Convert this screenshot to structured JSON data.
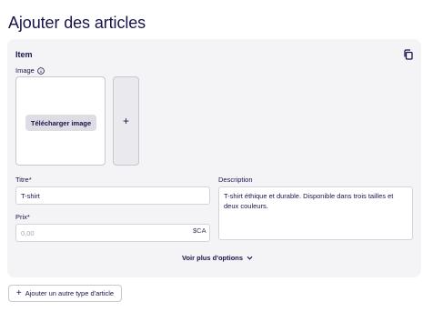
{
  "page": {
    "title": "Ajouter des articles"
  },
  "item_card": {
    "title": "Item",
    "copy_icon": "copy-icon",
    "image": {
      "label": "Image",
      "info_icon": "info-icon",
      "upload_button_label": "Télécharger image",
      "add_icon": "+"
    },
    "title_field": {
      "label": "Titre*",
      "value": "T-shirt"
    },
    "price_field": {
      "label": "Prix*",
      "placeholder": "0,00",
      "currency": "$CA"
    },
    "description_field": {
      "label": "Description",
      "value": "T-shirt éthique et durable. Disponible dans trois tailles et deux couleurs."
    },
    "more_options": {
      "label": "Voir plus d'options",
      "icon": "chevron-down-icon"
    }
  },
  "add_type_button": {
    "icon": "+",
    "label": "Ajouter un autre type d'article"
  },
  "colors": {
    "text": "#17144a",
    "card_background": "#f4f4f6",
    "border": "#c7c7cf",
    "upload_button": "#dedde4"
  }
}
